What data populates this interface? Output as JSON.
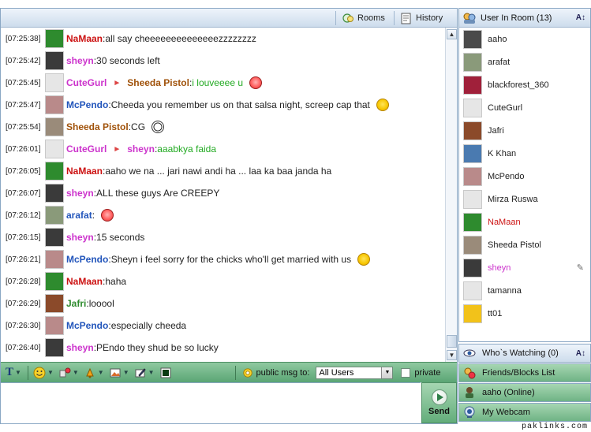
{
  "toolbar": {
    "rooms_label": "Rooms",
    "history_label": "History"
  },
  "messages": [
    {
      "time": "[07:25:38]",
      "nick": "NaMaan",
      "nick_color": "#cc1111",
      "text": "all say cheeeeeeeeeeeeeezzzzzzzz",
      "avatar_color": "#2e8b2e"
    },
    {
      "time": "[07:25:42]",
      "nick": "sheyn",
      "nick_color": "#cc33cc",
      "text": "30 seconds left",
      "avatar_color": "#3a3a3a"
    },
    {
      "time": "[07:25:45]",
      "nick": "CuteGurl",
      "nick_color": "#cc33cc",
      "to": "Sheeda Pistol",
      "to_color": "#a0520a",
      "text": "i louveeee u",
      "text_color": "#22aa22",
      "emoticon": "kiss",
      "avatar_color": "#e6e6e6"
    },
    {
      "time": "[07:25:47]",
      "nick": "McPendo",
      "nick_color": "#2255bb",
      "text": "Cheeda you remember us on that salsa night, screep cap that",
      "emoticon": "smile",
      "avatar_color": "#b98a8a"
    },
    {
      "time": "[07:25:54]",
      "nick": "Sheeda Pistol",
      "nick_color": "#a0520a",
      "text": "CG",
      "emoticon": "happy",
      "avatar_color": "#9a8b7a"
    },
    {
      "time": "[07:26:01]",
      "nick": "CuteGurl",
      "nick_color": "#cc33cc",
      "to": "sheyn",
      "to_color": "#cc33cc",
      "text": "aaabkya faida",
      "text_color": "#22aa22",
      "avatar_color": "#e6e6e6"
    },
    {
      "time": "[07:26:05]",
      "nick": "NaMaan",
      "nick_color": "#cc1111",
      "text": "aaho we na ... jari nawi andi ha ... laa ka baa janda ha",
      "avatar_color": "#2e8b2e"
    },
    {
      "time": "[07:26:07]",
      "nick": "sheyn",
      "nick_color": "#cc33cc",
      "text": "ALL these guys Are CREEPY",
      "avatar_color": "#3a3a3a"
    },
    {
      "time": "[07:26:12]",
      "nick": "arafat",
      "nick_color": "#2255bb",
      "text": "",
      "emoticon": "kiss",
      "avatar_color": "#8a9a7a"
    },
    {
      "time": "[07:26:15]",
      "nick": "sheyn",
      "nick_color": "#cc33cc",
      "text": "15 seconds",
      "avatar_color": "#3a3a3a"
    },
    {
      "time": "[07:26:21]",
      "nick": "McPendo",
      "nick_color": "#2255bb",
      "text": "Sheyn i feel sorry for the chicks who'll get married with us",
      "emoticon": "grin",
      "avatar_color": "#b98a8a"
    },
    {
      "time": "[07:26:28]",
      "nick": "NaMaan",
      "nick_color": "#cc1111",
      "text": "haha",
      "avatar_color": "#2e8b2e"
    },
    {
      "time": "[07:26:29]",
      "nick": "Jafri",
      "nick_color": "#2e8b2e",
      "text": "looool",
      "avatar_color": "#8b4a2a"
    },
    {
      "time": "[07:26:30]",
      "nick": "McPendo",
      "nick_color": "#2255bb",
      "text": "especially cheeda",
      "avatar_color": "#b98a8a"
    },
    {
      "time": "[07:26:40]",
      "nick": "sheyn",
      "nick_color": "#cc33cc",
      "text": "PEndo they shud be so lucky",
      "avatar_color": "#3a3a3a"
    }
  ],
  "format_bar": {
    "text_format_label": "T",
    "public_msg_label": "public msg to:",
    "recipient_value": "All Users",
    "private_label": "private"
  },
  "input": {
    "value": "",
    "send_label": "Send"
  },
  "users_panel": {
    "title": "User In Room (13)",
    "sort_label": "A↕",
    "users": [
      {
        "name": "aaho",
        "color": "#222222",
        "avatar_color": "#4a4a4a"
      },
      {
        "name": "arafat",
        "color": "#222222",
        "avatar_color": "#8a9a7a"
      },
      {
        "name": "blackforest_360",
        "color": "#222222",
        "avatar_color": "#a0203a"
      },
      {
        "name": "CuteGurl",
        "color": "#222222",
        "avatar_color": "#e6e6e6"
      },
      {
        "name": "Jafri",
        "color": "#222222",
        "avatar_color": "#8b4a2a"
      },
      {
        "name": "K Khan",
        "color": "#222222",
        "avatar_color": "#4a7ab0"
      },
      {
        "name": "McPendo",
        "color": "#222222",
        "avatar_color": "#b98a8a"
      },
      {
        "name": "Mirza Ruswa",
        "color": "#222222",
        "avatar_color": "#e6e6e6"
      },
      {
        "name": "NaMaan",
        "color": "#cc1111",
        "avatar_color": "#2e8b2e"
      },
      {
        "name": "Sheeda Pistol",
        "color": "#222222",
        "avatar_color": "#9a8b7a"
      },
      {
        "name": "sheyn",
        "color": "#cc33cc",
        "avatar_color": "#3a3a3a",
        "typing": true
      },
      {
        "name": "tamanna",
        "color": "#222222",
        "avatar_color": "#e6e6e6"
      },
      {
        "name": "tt01",
        "color": "#222222",
        "avatar_color": "#f2c21a"
      }
    ]
  },
  "side_rows": {
    "watching": "Who`s Watching (0)",
    "blocks": "Friends/Blocks List",
    "me": "aaho (Online)",
    "webcam": "My Webcam"
  },
  "watermark": "paklinks.com"
}
